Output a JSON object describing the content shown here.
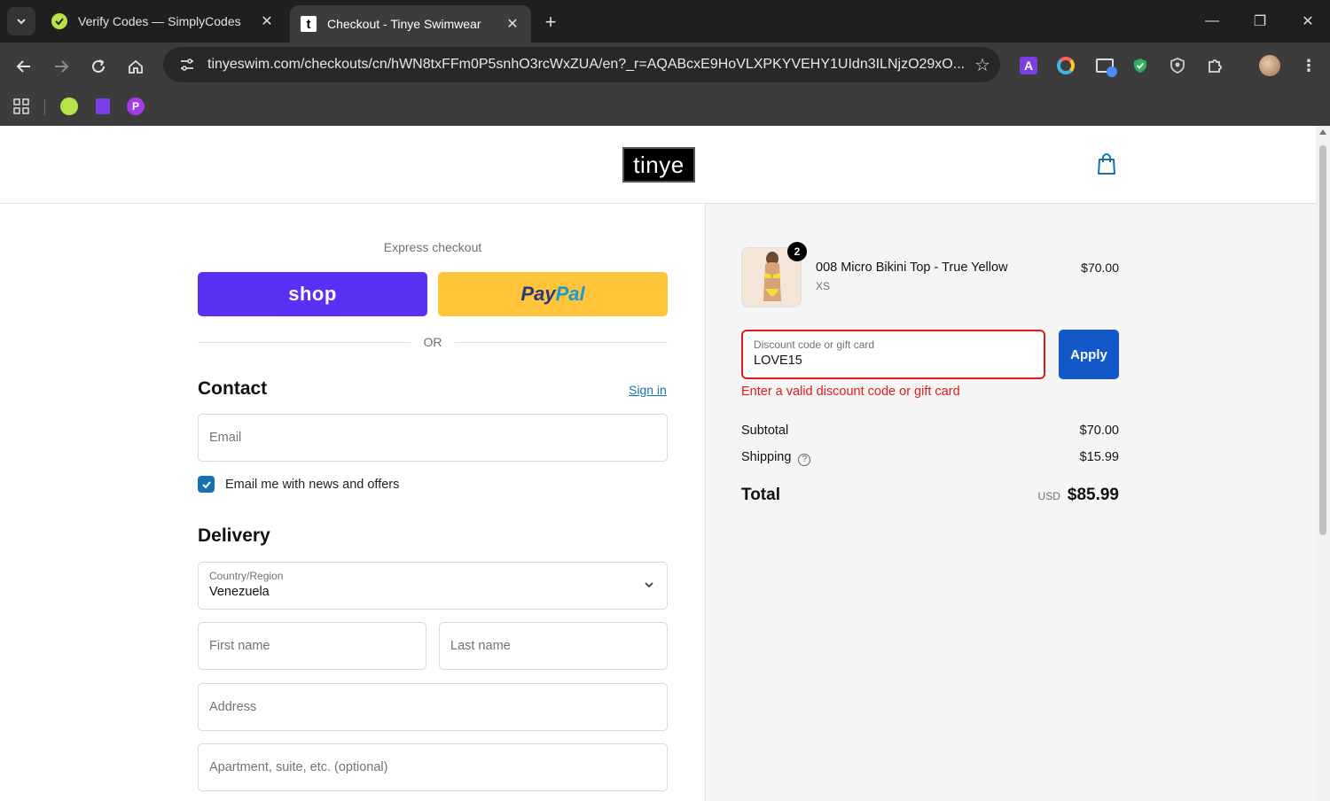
{
  "browser": {
    "tabs": [
      {
        "title": "Verify Codes — SimplyCodes",
        "active": false,
        "favicon": "simplycodes-icon"
      },
      {
        "title": "Checkout - Tinye Swimwear",
        "active": true,
        "favicon": "tinye-t-icon"
      }
    ],
    "url": "tinyeswim.com/checkouts/cn/hWN8txFFm0P5snhO3rcWxZUA/en?_r=AQABcxE9HoVLXPKYVEHY1UIdn3ILNjzO29xO...",
    "tab_close_glyph": "✕",
    "new_tab_glyph": "+",
    "window_controls": {
      "minimize": "—",
      "restore": "❐",
      "close": "✕"
    },
    "favicon_letter": "t"
  },
  "header": {
    "logo": "tinye"
  },
  "express": {
    "title": "Express checkout",
    "shop_label": "shop",
    "paypal_part1": "Pay",
    "paypal_part2": "Pal",
    "or_label": "OR"
  },
  "contact": {
    "title": "Contact",
    "signin": "Sign in",
    "email_placeholder": "Email",
    "newsletter_label": "Email me with news and offers",
    "newsletter_checked": true
  },
  "delivery": {
    "title": "Delivery",
    "country_label": "Country/Region",
    "country_value": "Venezuela",
    "first_name_placeholder": "First name",
    "last_name_placeholder": "Last name",
    "address_placeholder": "Address",
    "apartment_placeholder": "Apartment, suite, etc. (optional)"
  },
  "order": {
    "quantity": "2",
    "product_name": "008 Micro Bikini Top - True Yellow",
    "variant": "XS",
    "price": "$70.00",
    "discount_label": "Discount code or gift card",
    "discount_value": "LOVE15",
    "apply_label": "Apply",
    "error": "Enter a valid discount code or gift card",
    "subtotal_label": "Subtotal",
    "subtotal_value": "$70.00",
    "shipping_label": "Shipping",
    "shipping_value": "$15.99",
    "total_label": "Total",
    "currency": "USD",
    "total_value": "$85.99",
    "help_glyph": "?"
  },
  "colors": {
    "shop_purple": "#5a31f4",
    "paypal_yellow": "#ffc439",
    "error_red": "#dd1d1d",
    "link_blue": "#1773b0"
  }
}
